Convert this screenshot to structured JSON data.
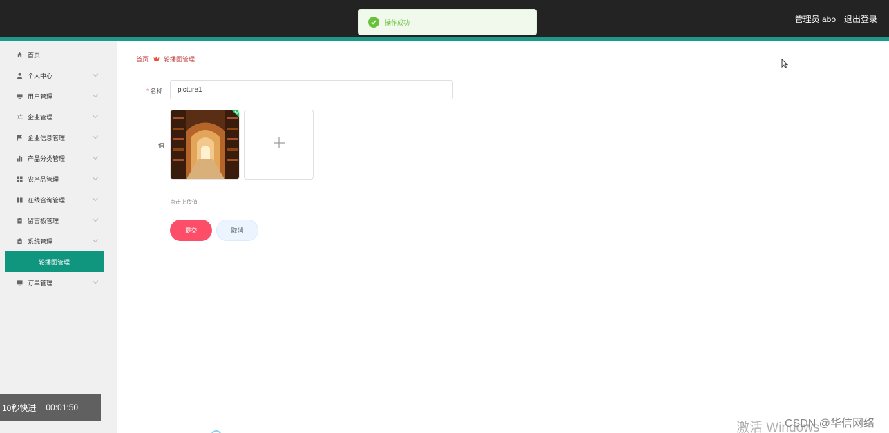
{
  "header": {
    "user_label": "管理员 abo",
    "logout_label": "退出登录",
    "accent_color": "#1b9a8a"
  },
  "toast": {
    "message": "操作成功",
    "icon": "check-circle-icon",
    "color": "#67c23a"
  },
  "sidebar": {
    "items": [
      {
        "label": "首页",
        "icon": "home-icon",
        "has_chevron": false
      },
      {
        "label": "个人中心",
        "icon": "person-icon",
        "has_chevron": true
      },
      {
        "label": "用户管理",
        "icon": "monitor-icon",
        "has_chevron": true
      },
      {
        "label": "企业管理",
        "icon": "sliders-icon",
        "has_chevron": true
      },
      {
        "label": "企业信息管理",
        "icon": "flag-icon",
        "has_chevron": true
      },
      {
        "label": "产品分类管理",
        "icon": "bar-chart-icon",
        "has_chevron": true
      },
      {
        "label": "农产品管理",
        "icon": "grid-icon",
        "has_chevron": true
      },
      {
        "label": "在线咨询管理",
        "icon": "grid-icon",
        "has_chevron": true
      },
      {
        "label": "留言板管理",
        "icon": "clipboard-icon",
        "has_chevron": true
      },
      {
        "label": "系统管理",
        "icon": "clipboard-icon",
        "has_chevron": true
      },
      {
        "label": "订单管理",
        "icon": "monitor-icon",
        "has_chevron": true
      }
    ],
    "active_subitem": "轮播图管理",
    "active_color": "#10957f"
  },
  "breadcrumb": {
    "home": "首页",
    "current": "轮播图管理"
  },
  "form": {
    "name_label": "名称",
    "name_value": "picture1",
    "value_label": "值",
    "upload_hint": "点击上传值",
    "submit_label": "提交",
    "cancel_label": "取消",
    "submit_color": "#fc4e68"
  },
  "video_overlay": {
    "speed_label": "10秒快进",
    "time": "00:01:50"
  },
  "watermarks": {
    "windows": "激活 Windows",
    "csdn": "CSDN @华信网络"
  }
}
